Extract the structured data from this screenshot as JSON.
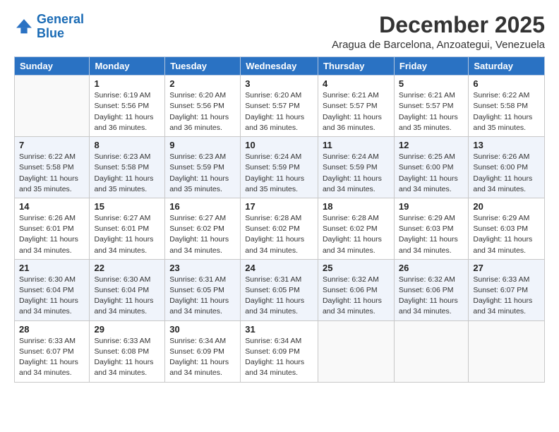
{
  "logo": {
    "line1": "General",
    "line2": "Blue"
  },
  "title": "December 2025",
  "subtitle": "Aragua de Barcelona, Anzoategui, Venezuela",
  "weekdays": [
    "Sunday",
    "Monday",
    "Tuesday",
    "Wednesday",
    "Thursday",
    "Friday",
    "Saturday"
  ],
  "weeks": [
    [
      {
        "day": "",
        "info": ""
      },
      {
        "day": "1",
        "info": "Sunrise: 6:19 AM\nSunset: 5:56 PM\nDaylight: 11 hours\nand 36 minutes."
      },
      {
        "day": "2",
        "info": "Sunrise: 6:20 AM\nSunset: 5:56 PM\nDaylight: 11 hours\nand 36 minutes."
      },
      {
        "day": "3",
        "info": "Sunrise: 6:20 AM\nSunset: 5:57 PM\nDaylight: 11 hours\nand 36 minutes."
      },
      {
        "day": "4",
        "info": "Sunrise: 6:21 AM\nSunset: 5:57 PM\nDaylight: 11 hours\nand 36 minutes."
      },
      {
        "day": "5",
        "info": "Sunrise: 6:21 AM\nSunset: 5:57 PM\nDaylight: 11 hours\nand 35 minutes."
      },
      {
        "day": "6",
        "info": "Sunrise: 6:22 AM\nSunset: 5:58 PM\nDaylight: 11 hours\nand 35 minutes."
      }
    ],
    [
      {
        "day": "7",
        "info": "Sunrise: 6:22 AM\nSunset: 5:58 PM\nDaylight: 11 hours\nand 35 minutes."
      },
      {
        "day": "8",
        "info": "Sunrise: 6:23 AM\nSunset: 5:58 PM\nDaylight: 11 hours\nand 35 minutes."
      },
      {
        "day": "9",
        "info": "Sunrise: 6:23 AM\nSunset: 5:59 PM\nDaylight: 11 hours\nand 35 minutes."
      },
      {
        "day": "10",
        "info": "Sunrise: 6:24 AM\nSunset: 5:59 PM\nDaylight: 11 hours\nand 35 minutes."
      },
      {
        "day": "11",
        "info": "Sunrise: 6:24 AM\nSunset: 5:59 PM\nDaylight: 11 hours\nand 34 minutes."
      },
      {
        "day": "12",
        "info": "Sunrise: 6:25 AM\nSunset: 6:00 PM\nDaylight: 11 hours\nand 34 minutes."
      },
      {
        "day": "13",
        "info": "Sunrise: 6:26 AM\nSunset: 6:00 PM\nDaylight: 11 hours\nand 34 minutes."
      }
    ],
    [
      {
        "day": "14",
        "info": "Sunrise: 6:26 AM\nSunset: 6:01 PM\nDaylight: 11 hours\nand 34 minutes."
      },
      {
        "day": "15",
        "info": "Sunrise: 6:27 AM\nSunset: 6:01 PM\nDaylight: 11 hours\nand 34 minutes."
      },
      {
        "day": "16",
        "info": "Sunrise: 6:27 AM\nSunset: 6:02 PM\nDaylight: 11 hours\nand 34 minutes."
      },
      {
        "day": "17",
        "info": "Sunrise: 6:28 AM\nSunset: 6:02 PM\nDaylight: 11 hours\nand 34 minutes."
      },
      {
        "day": "18",
        "info": "Sunrise: 6:28 AM\nSunset: 6:02 PM\nDaylight: 11 hours\nand 34 minutes."
      },
      {
        "day": "19",
        "info": "Sunrise: 6:29 AM\nSunset: 6:03 PM\nDaylight: 11 hours\nand 34 minutes."
      },
      {
        "day": "20",
        "info": "Sunrise: 6:29 AM\nSunset: 6:03 PM\nDaylight: 11 hours\nand 34 minutes."
      }
    ],
    [
      {
        "day": "21",
        "info": "Sunrise: 6:30 AM\nSunset: 6:04 PM\nDaylight: 11 hours\nand 34 minutes."
      },
      {
        "day": "22",
        "info": "Sunrise: 6:30 AM\nSunset: 6:04 PM\nDaylight: 11 hours\nand 34 minutes."
      },
      {
        "day": "23",
        "info": "Sunrise: 6:31 AM\nSunset: 6:05 PM\nDaylight: 11 hours\nand 34 minutes."
      },
      {
        "day": "24",
        "info": "Sunrise: 6:31 AM\nSunset: 6:05 PM\nDaylight: 11 hours\nand 34 minutes."
      },
      {
        "day": "25",
        "info": "Sunrise: 6:32 AM\nSunset: 6:06 PM\nDaylight: 11 hours\nand 34 minutes."
      },
      {
        "day": "26",
        "info": "Sunrise: 6:32 AM\nSunset: 6:06 PM\nDaylight: 11 hours\nand 34 minutes."
      },
      {
        "day": "27",
        "info": "Sunrise: 6:33 AM\nSunset: 6:07 PM\nDaylight: 11 hours\nand 34 minutes."
      }
    ],
    [
      {
        "day": "28",
        "info": "Sunrise: 6:33 AM\nSunset: 6:07 PM\nDaylight: 11 hours\nand 34 minutes."
      },
      {
        "day": "29",
        "info": "Sunrise: 6:33 AM\nSunset: 6:08 PM\nDaylight: 11 hours\nand 34 minutes."
      },
      {
        "day": "30",
        "info": "Sunrise: 6:34 AM\nSunset: 6:09 PM\nDaylight: 11 hours\nand 34 minutes."
      },
      {
        "day": "31",
        "info": "Sunrise: 6:34 AM\nSunset: 6:09 PM\nDaylight: 11 hours\nand 34 minutes."
      },
      {
        "day": "",
        "info": ""
      },
      {
        "day": "",
        "info": ""
      },
      {
        "day": "",
        "info": ""
      }
    ]
  ]
}
